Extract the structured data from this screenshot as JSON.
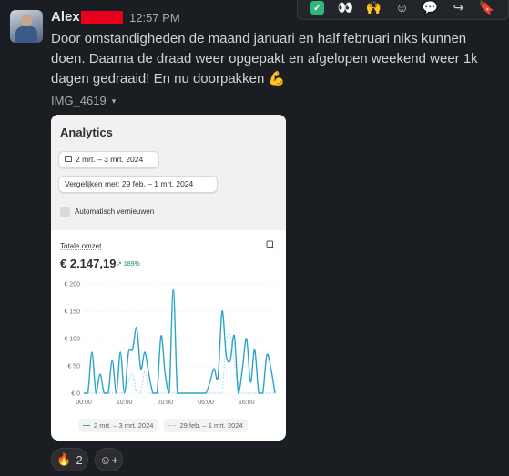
{
  "message": {
    "author": "Alex",
    "time": "12:57 PM",
    "text": "Door omstandigheden de maand januari en half februari niks kunnen doen. Daarna de draad weer opgepakt en afgelopen weekend weer 1k dagen gedraaid! En nu doorpakken",
    "text_emoji": "💪",
    "attachment_name": "IMG_4619",
    "attachment_caret": "▾"
  },
  "hover_actions": [
    {
      "name": "checkmark-reaction",
      "glyph": "✓"
    },
    {
      "name": "eyes-reaction",
      "glyph": "👀"
    },
    {
      "name": "raised-hands-reaction",
      "glyph": "🙌"
    },
    {
      "name": "add-reaction-icon",
      "glyph": "☺"
    },
    {
      "name": "reply-in-thread-icon",
      "glyph": "💬"
    },
    {
      "name": "share-icon",
      "glyph": "↪"
    },
    {
      "name": "bookmark-icon",
      "glyph": "🔖"
    }
  ],
  "screenshot": {
    "title": "Analytics",
    "date_range": "2 mrt. – 3 mrt. 2024",
    "compare": "Vergelijken met: 29 feb. – 1 mrt. 2024",
    "auto_refresh": "Automatisch vernieuwen",
    "metric_label": "Totale omzet",
    "metric_value": "€ 2.147,19",
    "metric_change": "↗ 189%"
  },
  "chart_data": {
    "type": "line",
    "title": "",
    "xlabel": "",
    "ylabel": "",
    "ylim": [
      0,
      200
    ],
    "yticks": [
      "€ 200",
      "€ 150",
      "€ 100",
      "€ 50",
      "€ 0"
    ],
    "xticks": [
      "00:00",
      "10:00",
      "20:00",
      "06:00",
      "16:00"
    ],
    "x": [
      0,
      1,
      2,
      3,
      4,
      5,
      6,
      7,
      8,
      9,
      10,
      11,
      12,
      13,
      14,
      15,
      16,
      17,
      18,
      19,
      20,
      21,
      22,
      23,
      24,
      25,
      26,
      27,
      28,
      29,
      30,
      31,
      32,
      33,
      34,
      35,
      36,
      37,
      38,
      39,
      40,
      41,
      42,
      43,
      44,
      45,
      46,
      47
    ],
    "series": [
      {
        "name": "2 mrt. – 3 mrt. 2024",
        "color": "#2ea3c6",
        "style": "solid",
        "values": [
          0,
          0,
          75,
          0,
          35,
          0,
          0,
          60,
          0,
          75,
          0,
          75,
          80,
          120,
          45,
          75,
          35,
          0,
          0,
          105,
          35,
          0,
          190,
          0,
          0,
          0,
          0,
          0,
          0,
          0,
          0,
          20,
          45,
          30,
          150,
          70,
          60,
          105,
          0,
          45,
          100,
          20,
          80,
          0,
          0,
          70,
          45,
          0
        ]
      },
      {
        "name": "29 feb. – 1 mrt. 2024",
        "color": "#8fcfe0",
        "style": "dotted",
        "values": [
          0,
          0,
          0,
          0,
          0,
          0,
          0,
          0,
          0,
          0,
          0,
          20,
          35,
          0,
          0,
          40,
          0,
          0,
          0,
          0,
          0,
          0,
          0,
          0,
          0,
          0,
          0,
          0,
          0,
          0,
          0,
          0,
          0,
          0,
          0,
          95,
          105,
          60,
          0,
          0,
          0,
          0,
          0,
          0,
          0,
          0,
          0,
          0
        ]
      }
    ]
  },
  "reactions": [
    {
      "emoji": "🔥",
      "count": "2"
    }
  ],
  "add_reaction_glyph": "☺+"
}
